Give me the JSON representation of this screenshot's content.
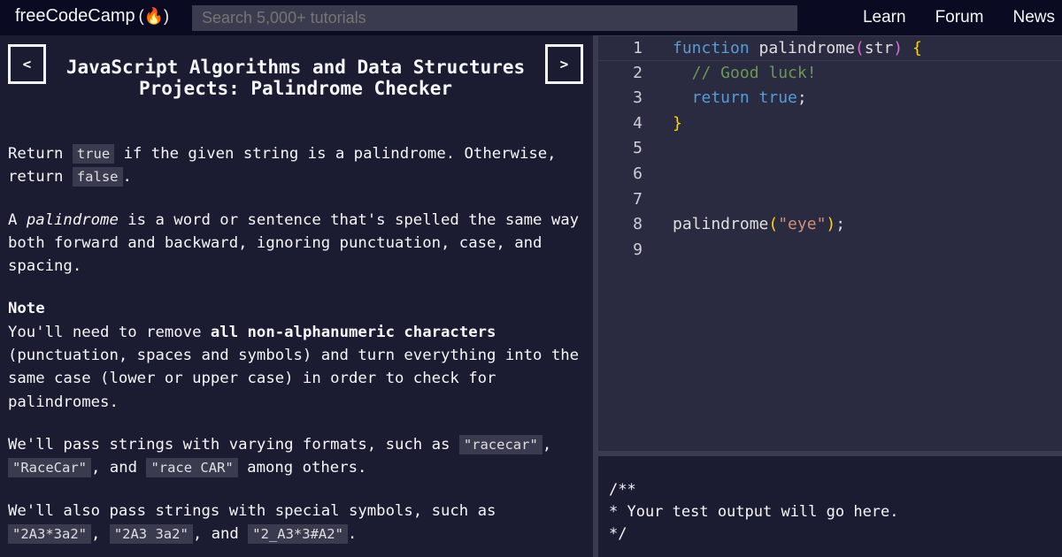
{
  "navbar": {
    "logo_text": "freeCodeCamp",
    "logo_icon": "(🔥)",
    "search_placeholder": "Search 5,000+ tutorials",
    "links": [
      "Learn",
      "Forum",
      "News"
    ]
  },
  "challenge": {
    "prev_label": "<",
    "next_label": ">",
    "title": "JavaScript Algorithms and Data Structures Projects: Palindrome Checker",
    "p1": {
      "a": "Return ",
      "code1": "true",
      "b": " if the given string is a palindrome. Otherwise, return ",
      "code2": "false",
      "c": "."
    },
    "p2": {
      "a": "A ",
      "em": "palindrome",
      "b": " is a word or sentence that's spelled the same way both forward and backward, ignoring punctuation, case, and spacing."
    },
    "p3": {
      "heading": "Note",
      "a": "You'll need to remove ",
      "strong": "all non-alphanumeric characters",
      "b": " (punctuation, spaces and symbols) and turn everything into the same case (lower or upper case) in order to check for palindromes."
    },
    "p4": {
      "a": "We'll pass strings with varying formats, such as ",
      "code1": "\"racecar\"",
      "sep1": ", ",
      "code2": "\"RaceCar\"",
      "sep2": ", and ",
      "code3": "\"race CAR\"",
      "b": " among others."
    },
    "p5": {
      "a": "We'll also pass strings with special symbols, such as ",
      "code1": "\"2A3*3a2\"",
      "sep1": ", ",
      "code2": "\"2A3 3a2\"",
      "sep2": ", and ",
      "code3": "\"2_A3*3#A2\"",
      "b": "."
    }
  },
  "editor": {
    "line_numbers": [
      "1",
      "2",
      "3",
      "4",
      "5",
      "6",
      "7",
      "8",
      "9"
    ],
    "l1": {
      "kw": "function",
      "name": " palindrome",
      "open": "(",
      "param": "str",
      "close": ")",
      "brace": " {"
    },
    "l2": {
      "comment": "  // Good luck!"
    },
    "l3": {
      "kw": "  return",
      "val": " true",
      "semi": ";"
    },
    "l4": {
      "brace": "}"
    },
    "l8": {
      "name": "palindrome",
      "open": "(",
      "str": "\"eye\"",
      "close": ")",
      "semi": ";"
    }
  },
  "output": {
    "text": "/**\n* Your test output will go here.\n*/"
  },
  "colors": {
    "bg_dark": "#0a0a23",
    "bg_panel": "#1b1b32",
    "bg_editor": "#2a2a40",
    "keyword": "#569cd6",
    "comment": "#6a9955",
    "string": "#ce9178",
    "brace": "#ffd700"
  }
}
